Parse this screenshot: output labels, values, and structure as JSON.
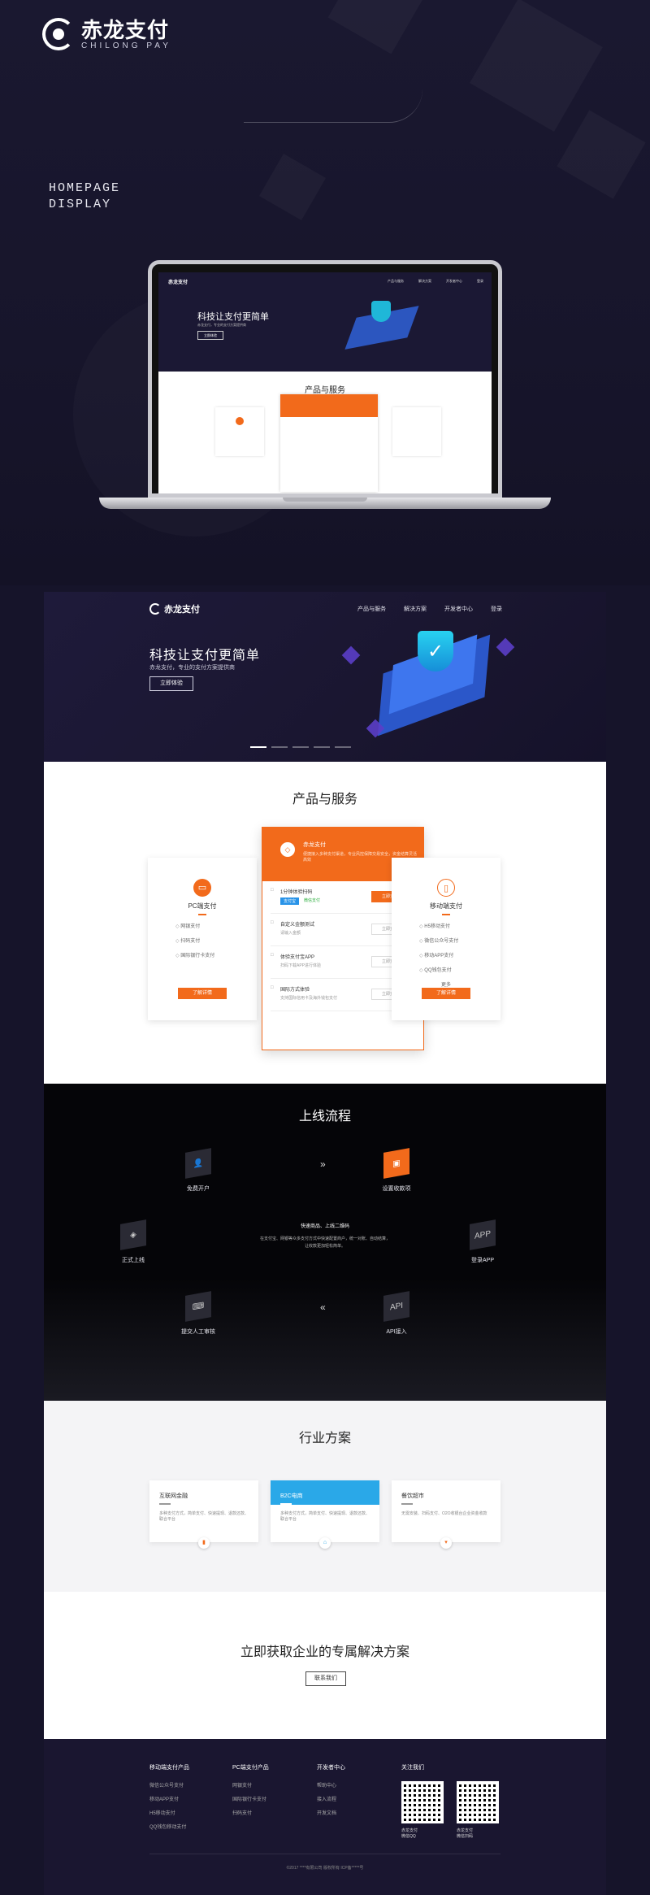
{
  "brand": {
    "name_cn": "赤龙支付",
    "name_en": "CHILONG PAY"
  },
  "showcase": {
    "label_line1": "HOMEPAGE",
    "label_line2": "DISPLAY"
  },
  "nav": {
    "items": [
      "产品与服务",
      "解决方案",
      "开发者中心",
      "登录"
    ]
  },
  "hero": {
    "title": "科技让支付更简单",
    "subtitle": "赤龙支付，专业的支付方案提供商",
    "cta": "立即体验",
    "slides": 5,
    "active_slide": 1
  },
  "products": {
    "title": "产品与服务",
    "pc": {
      "name": "PC端支付",
      "items": [
        "网银支付",
        "扫码支付",
        "国际银行卡支付"
      ],
      "button": "了解详情"
    },
    "mobile": {
      "name": "移动端支付",
      "items": [
        "H5移动支付",
        "微信公众号支付",
        "移动APP支付",
        "QQ钱包支付"
      ],
      "more": "更多",
      "button": "了解详情"
    },
    "center": {
      "title": "赤龙支付",
      "desc": "便捷接入多种支付渠道，专业风控保障交易安全，资金结算灵活高效",
      "rows": [
        {
          "label": "1分钟体验扫码",
          "pay_a": "支付宝",
          "pay_w": "微信支付",
          "button": "立即支付",
          "active": true
        },
        {
          "label": "自定义金额测试",
          "sub": "请输入金额",
          "button": "立即支付"
        },
        {
          "label": "体验支付宝APP",
          "sub": "扫码下载APP进行体验",
          "button": "立即支付"
        },
        {
          "label": "国际方式体验",
          "sub": "支持国际信用卡及海外钱包支付",
          "button": "立即支付"
        }
      ]
    }
  },
  "flow": {
    "title": "上线流程",
    "steps": [
      "免费开户",
      "设置收款项",
      "登录APP",
      "API接入",
      "提交人工审核",
      "正式上线"
    ],
    "center_title": "快速商品、上线二维码",
    "center_text": "在支付宝、网银等众多支付方式中快速配置商户，统一对账、自动结算，让收款更加轻松简单。"
  },
  "industry": {
    "title": "行业方案",
    "cards": [
      {
        "title": "互联网金融",
        "desc": "多种支付方式，简单支付、快速提现、退款还款、联合平台"
      },
      {
        "title": "B2C电商",
        "desc": "多种支付方式，简单支付、快速提现、退款还款、联合平台"
      },
      {
        "title": "餐饮超市",
        "desc": "无需安装、扫码支付、O2O收银台企业资金收款"
      }
    ]
  },
  "cta": {
    "title": "立即获取企业的专属解决方案",
    "button": "联系我们"
  },
  "footer": {
    "cols": [
      {
        "title": "移动端支付产品",
        "items": [
          "微信公众号支付",
          "移动APP支付",
          "H5移动支付",
          "QQ钱包移动支付"
        ]
      },
      {
        "title": "PC端支付产品",
        "items": [
          "网银支付",
          "国际银行卡支付",
          "扫码支付"
        ]
      },
      {
        "title": "开发者中心",
        "items": [
          "帮助中心",
          "接入流程",
          "开发文档"
        ]
      },
      {
        "title": "关注我们",
        "items": []
      }
    ],
    "qr1_label": "赤龙支付\n微信QQ",
    "qr2_label": "赤龙支付\n微信扫码",
    "copyright": "©2017 ****有限公司 版权所有 ICP备*****号"
  },
  "colors": {
    "accent": "#f26a1b",
    "dark_bg": "#16142a",
    "industry_active": "#2aa8e8"
  }
}
